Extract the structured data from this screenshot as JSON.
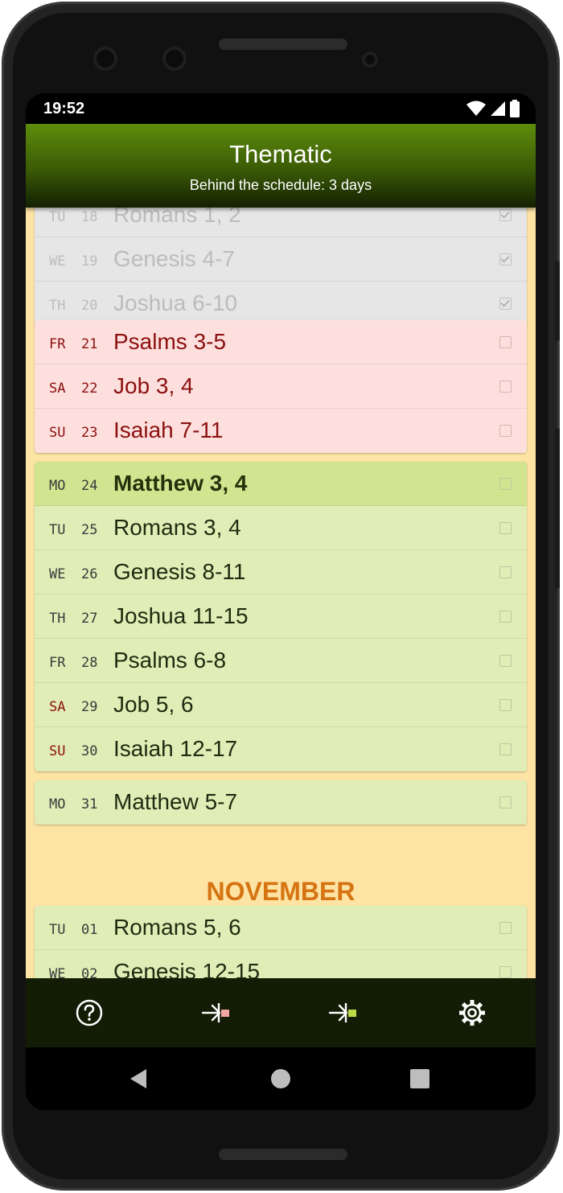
{
  "status_bar": {
    "time": "19:52"
  },
  "app_bar": {
    "title": "Thematic",
    "subtitle": "Behind the schedule:   3 days"
  },
  "groups": [
    {
      "state": "done",
      "rows": [
        {
          "dow": "TU",
          "day": "18",
          "reading": "Romans 1, 2",
          "checked": true
        },
        {
          "dow": "WE",
          "day": "19",
          "reading": "Genesis 4-7",
          "checked": true
        },
        {
          "dow": "TH",
          "day": "20",
          "reading": "Joshua 6-10",
          "checked": true
        }
      ]
    },
    {
      "state": "behind",
      "rows": [
        {
          "dow": "FR",
          "day": "21",
          "reading": "Psalms 3-5",
          "checked": false
        },
        {
          "dow": "SA",
          "day": "22",
          "reading": "Job 3, 4",
          "checked": false
        },
        {
          "dow": "SU",
          "day": "23",
          "reading": "Isaiah 7-11",
          "checked": false
        }
      ]
    },
    {
      "state": "week",
      "rows": [
        {
          "dow": "MO",
          "day": "24",
          "reading": "Matthew 3, 4",
          "checked": false,
          "today": true
        },
        {
          "dow": "TU",
          "day": "25",
          "reading": "Romans 3, 4",
          "checked": false
        },
        {
          "dow": "WE",
          "day": "26",
          "reading": "Genesis 8-11",
          "checked": false
        },
        {
          "dow": "TH",
          "day": "27",
          "reading": "Joshua 11-15",
          "checked": false
        },
        {
          "dow": "FR",
          "day": "28",
          "reading": "Psalms 6-8",
          "checked": false
        },
        {
          "dow": "SA",
          "day": "29",
          "reading": "Job 5, 6",
          "checked": false,
          "weekend": true
        },
        {
          "dow": "SU",
          "day": "30",
          "reading": "Isaiah 12-17",
          "checked": false,
          "weekend": true
        }
      ]
    },
    {
      "state": "week",
      "rows": [
        {
          "dow": "MO",
          "day": "31",
          "reading": "Matthew 5-7",
          "checked": false
        }
      ]
    },
    {
      "state": "week",
      "rows": [
        {
          "dow": "TU",
          "day": "01",
          "reading": "Romans 5, 6",
          "checked": false
        },
        {
          "dow": "WE",
          "day": "02",
          "reading": "Genesis 12-15",
          "checked": false
        }
      ]
    }
  ],
  "month_header": "NOVEMBER",
  "bottom_bar": {
    "buttons": [
      {
        "icon": "help-circle-icon"
      },
      {
        "icon": "jump-to-behind-icon",
        "accent": "#f2a7a2"
      },
      {
        "icon": "jump-to-today-icon",
        "accent": "#bcd94a"
      },
      {
        "icon": "settings-gear-icon"
      }
    ]
  },
  "colors": {
    "app_bar_top": "#5d8d0b",
    "list_background": "#fde3a4",
    "behind_row": "#fde0de",
    "behind_text": "#8c1010",
    "week_row": "#e1edb6",
    "today_row": "#d1e590",
    "month_text": "#d67412"
  }
}
